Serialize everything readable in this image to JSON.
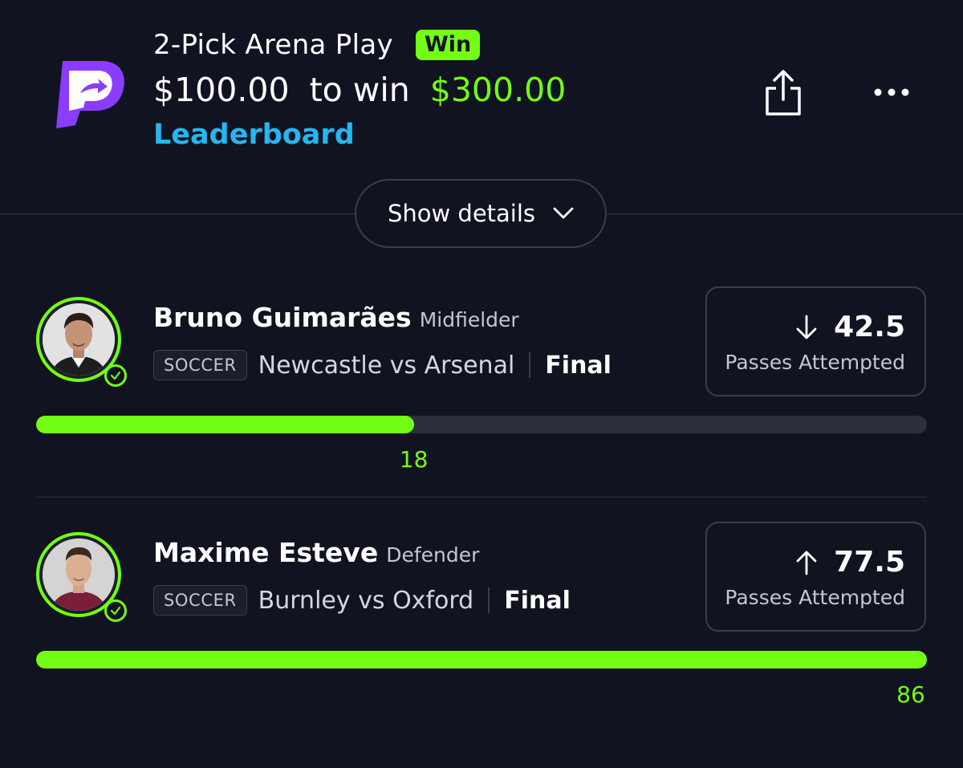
{
  "header": {
    "title": "2-Pick Arena Play",
    "badge": "Win",
    "stake": "$100.00",
    "to_win_text": "to win",
    "payout": "$300.00",
    "leaderboard_link": "Leaderboard",
    "share_icon": "share-icon",
    "more_icon": "more-icon"
  },
  "details_toggle": {
    "label": "Show details",
    "icon": "chevron-down-icon"
  },
  "picks": [
    {
      "player": "Bruno Guimarães",
      "position": "Midfielder",
      "sport": "SOCCER",
      "matchup": "Newcastle vs Arsenal",
      "status": "Final",
      "direction": "down",
      "line": "42.5",
      "stat": "Passes Attempted",
      "actual": "18",
      "progress_fraction": 0.424
    },
    {
      "player": "Maxime Esteve",
      "position": "Defender",
      "sport": "SOCCER",
      "matchup": "Burnley vs Oxford",
      "status": "Final",
      "direction": "up",
      "line": "77.5",
      "stat": "Passes Attempted",
      "actual": "86",
      "progress_fraction": 1.0
    }
  ],
  "colors": {
    "background": "#111420",
    "accent_green": "#73ff14",
    "link_blue": "#27b6f0",
    "brand_purple": "#7b2ff7"
  }
}
